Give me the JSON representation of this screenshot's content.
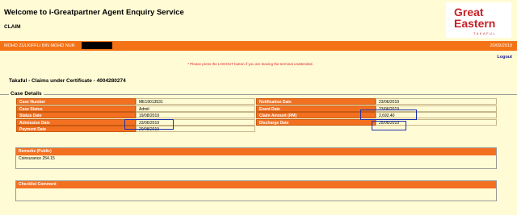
{
  "header": {
    "title": "Welcome to i-Greatpartner Agent Enquiry Service",
    "section": "CLAIM",
    "logo": {
      "line1": "Great",
      "line2": "Eastern",
      "sub": "TAKAFUL"
    }
  },
  "userbar": {
    "user": "MOHD ZULKIFFLI BIN MOHD NUR",
    "date": "20/09/2019"
  },
  "logout": "Logout",
  "warning": "* Please press the LOGOUT button if you are leaving the terminal unattended.",
  "certificate_title": "Takaful - Claims under Certificate - 4004280274",
  "case_details": {
    "legend": "Case Details",
    "left": [
      {
        "label": "Case Number",
        "value": "ME19013531"
      },
      {
        "label": "Case Status",
        "value": "Admit"
      },
      {
        "label": "Status Date",
        "value": "19/08/2019"
      },
      {
        "label": "Admission Date",
        "value": "23/06/2019"
      },
      {
        "label": "Payment Date",
        "value": "20/08/2019"
      }
    ],
    "right": [
      {
        "label": "Notification Date",
        "value": "23/06/2019"
      },
      {
        "label": "Event Date",
        "value": "23/06/2019"
      },
      {
        "label": "Claim Amount (RM)",
        "value": "2,692.40"
      },
      {
        "label": "Discharge Date",
        "value": "25/06/2019"
      }
    ]
  },
  "remarks": {
    "title": "Remarks (Public)",
    "text": "Coinsurance 254.15"
  },
  "checklist": {
    "title": "Checklist Comment",
    "text": ""
  },
  "colors": {
    "orange": "#f37021",
    "background": "#fffbd5",
    "highlight": "#1a2fb0",
    "logo_red": "#c62127"
  }
}
